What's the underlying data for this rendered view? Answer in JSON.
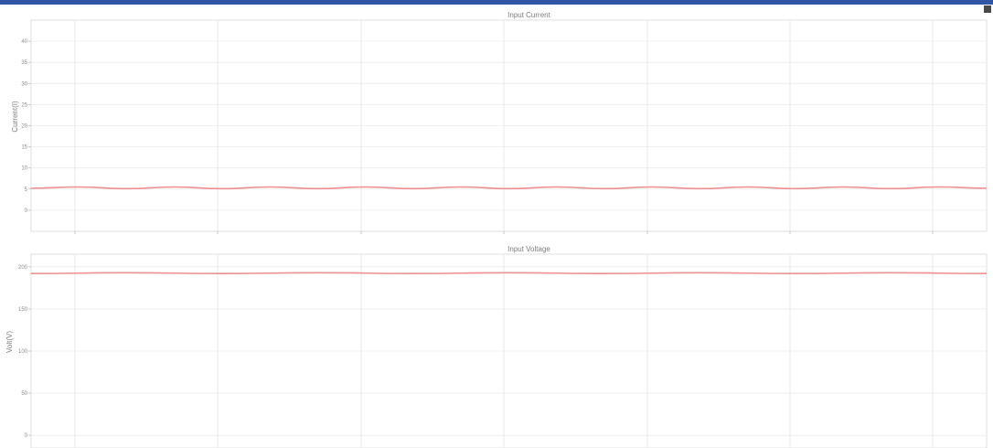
{
  "chart_data": [
    {
      "type": "line",
      "title": "Input Current",
      "xlabel": "",
      "ylabel": "Current(I)",
      "ylim": [
        -5,
        45
      ],
      "yticks": [
        0,
        5,
        10,
        15,
        20,
        25,
        30,
        35,
        40
      ],
      "grid": true,
      "series": [
        {
          "color": "#f08f8f",
          "x": [
            0,
            0.5,
            1,
            1.5,
            2,
            2.5,
            3,
            3.5,
            4,
            4.5,
            5,
            5.5,
            6,
            6.5,
            7,
            7.5,
            8,
            8.5,
            9,
            9.5,
            10
          ],
          "values": [
            5.2,
            5.5,
            5.1,
            5.5,
            5.1,
            5.5,
            5.1,
            5.5,
            5.1,
            5.5,
            5.1,
            5.5,
            5.1,
            5.5,
            5.1,
            5.5,
            5.1,
            5.5,
            5.1,
            5.5,
            5.2
          ]
        }
      ]
    },
    {
      "type": "line",
      "title": "Input Voltage",
      "xlabel": "",
      "ylabel": "Volt(V)",
      "ylim": [
        -15,
        215
      ],
      "yticks": [
        0,
        50,
        100,
        150,
        200
      ],
      "grid": true,
      "series": [
        {
          "color": "#f08f8f",
          "x": [
            0,
            1,
            2,
            3,
            4,
            5,
            6,
            7,
            8,
            9,
            10
          ],
          "values": [
            192,
            193,
            192,
            193,
            192,
            193,
            192,
            193,
            192,
            193,
            192
          ]
        }
      ]
    }
  ]
}
